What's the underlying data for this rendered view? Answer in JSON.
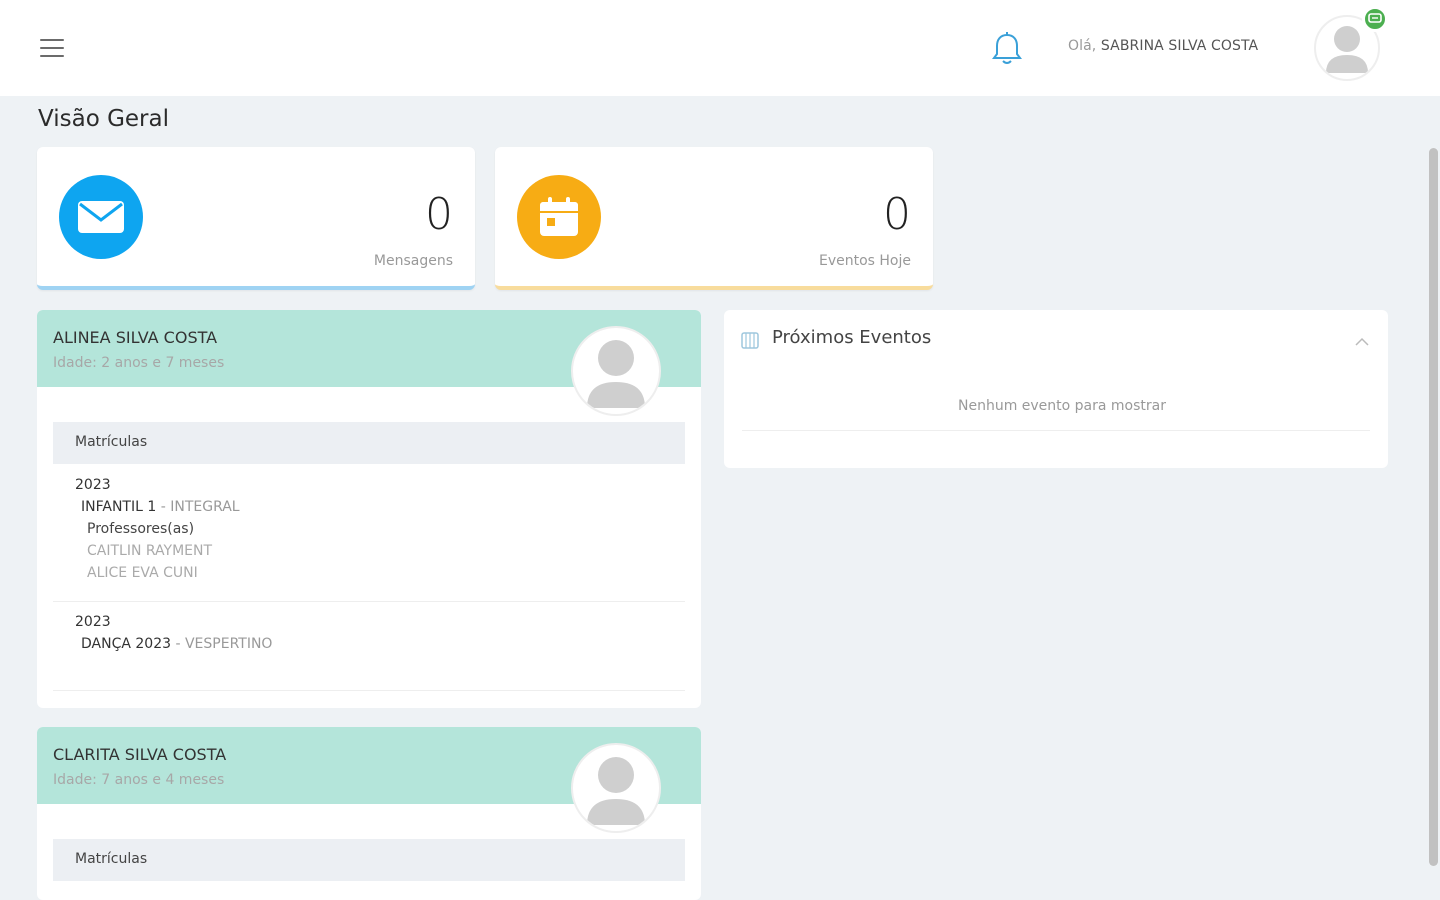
{
  "header": {
    "greeting_prefix": "Olá,",
    "user_name": "SABRINA SILVA COSTA"
  },
  "page": {
    "title": "Visão Geral"
  },
  "stats": [
    {
      "value": "0",
      "label": "Mensagens",
      "icon": "envelope-icon",
      "color": "#0ea5f0"
    },
    {
      "value": "0",
      "label": "Eventos Hoje",
      "icon": "calendar-icon",
      "color": "#f7ac14"
    }
  ],
  "students": [
    {
      "name": "ALINEA SILVA COSTA",
      "age": "Idade: 2 anos e 7 meses",
      "section_label": "Matrículas",
      "enrollments": [
        {
          "year": "2023",
          "course": "INFANTIL 1",
          "shift": " - INTEGRAL",
          "teachers_label": "Professores(as)",
          "teachers": [
            "CAITLIN RAYMENT",
            "ALICE EVA CUNI"
          ]
        },
        {
          "year": "2023",
          "course": "DANÇA 2023",
          "shift": " - VESPERTINO"
        }
      ]
    },
    {
      "name": "CLARITA SILVA COSTA",
      "age": "Idade: 7 anos e 4 meses",
      "section_label": "Matrículas"
    }
  ],
  "events": {
    "title": "Próximos Eventos",
    "empty_text": "Nenhum evento para mostrar"
  }
}
